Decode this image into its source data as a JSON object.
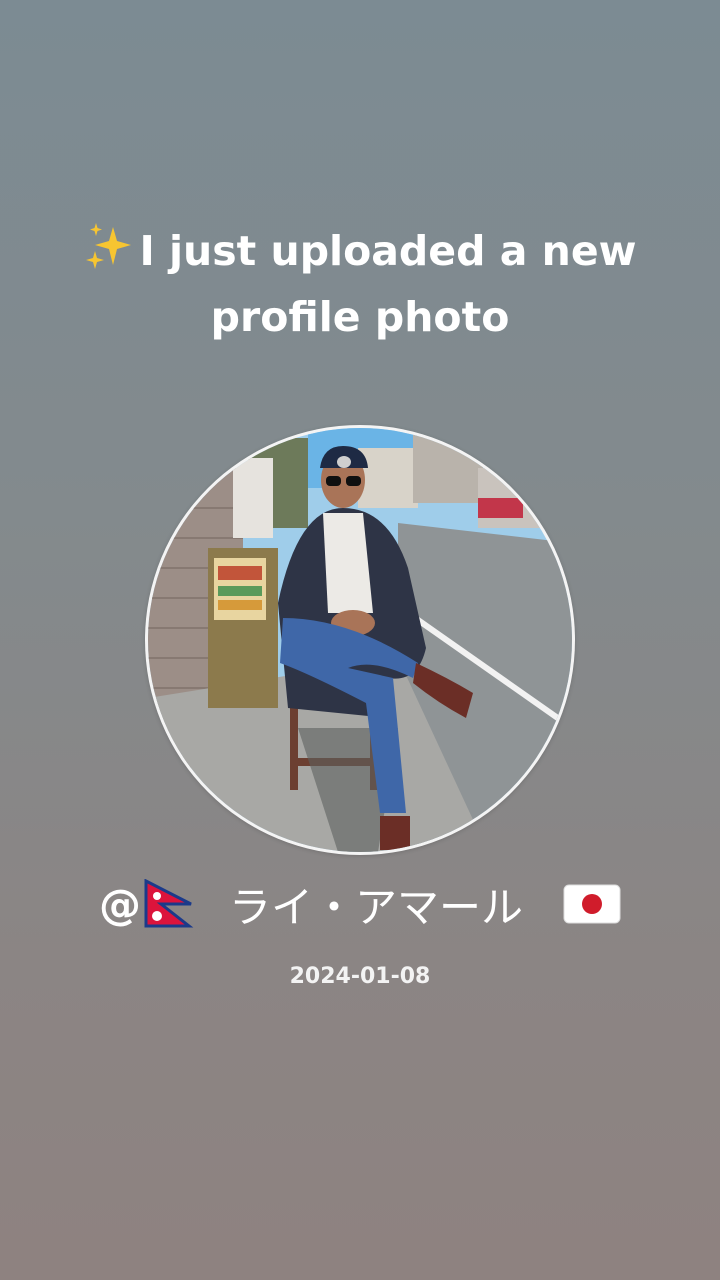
{
  "post": {
    "headline_icon": "sparkles-icon",
    "headline": "I just uploaded a new profile photo",
    "username_prefix": "@",
    "username_flag_left": "nepal-flag-icon",
    "username": "ライ・アマール",
    "username_flag_right": "japan-flag-icon",
    "date": "2024-01-08"
  },
  "colors": {
    "background_top": "#7c8b93",
    "background_bottom": "#8e8280",
    "text": "#ffffff",
    "avatar_ring": "#f4f4f4"
  }
}
